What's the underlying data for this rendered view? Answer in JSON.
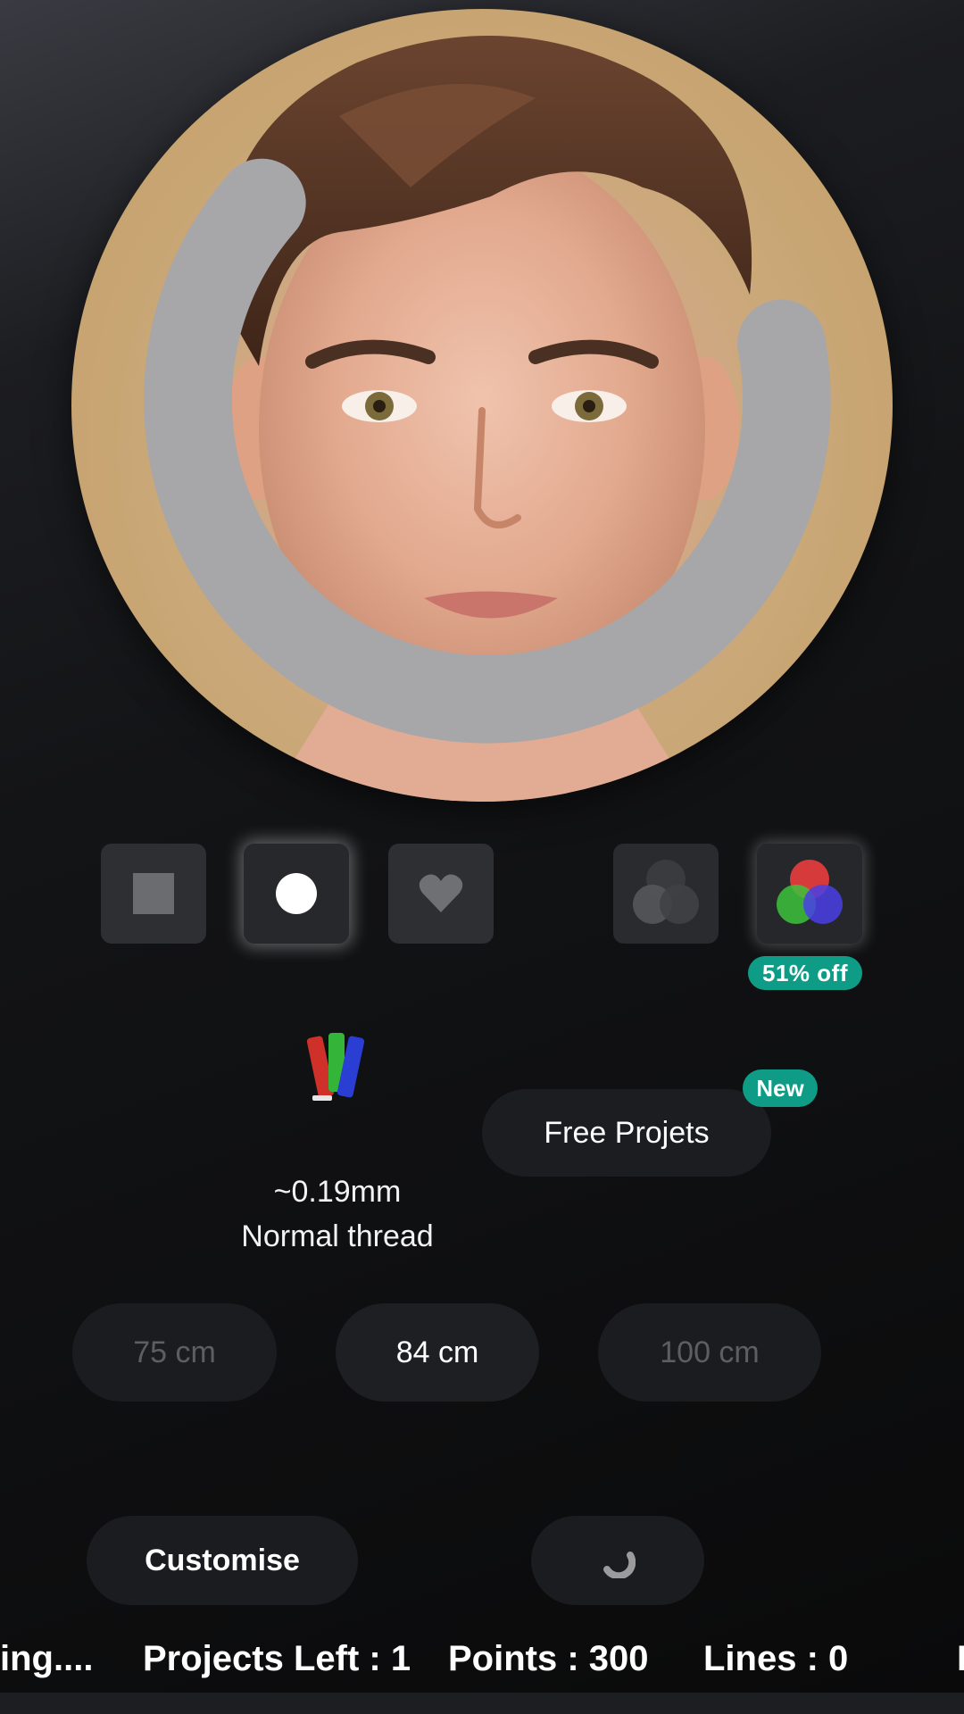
{
  "portrait": {
    "icon": "portrait-photo",
    "loading_icon": "spinner-icon"
  },
  "shapes": [
    {
      "icon": "square-icon",
      "active": false
    },
    {
      "icon": "circle-icon",
      "active": true
    },
    {
      "icon": "heart-icon",
      "active": false
    }
  ],
  "color_modes": [
    {
      "icon": "monochrome-circles-icon",
      "active": false
    },
    {
      "icon": "rgb-circles-icon",
      "active": true
    }
  ],
  "discount_badge": "51% off",
  "thread": {
    "icon": "thread-spools-icon",
    "size": "~0.19mm",
    "type": "Normal thread"
  },
  "free_projects": {
    "label": "Free Projets",
    "badge": "New"
  },
  "sizes": [
    {
      "label": "75 cm",
      "selected": false
    },
    {
      "label": "84 cm",
      "selected": true
    },
    {
      "label": "100 cm",
      "selected": false
    }
  ],
  "actions": {
    "customise_label": "Customise",
    "loader_icon": "spinner-icon"
  },
  "status": {
    "loading": "ing....",
    "projects_left": "Projects Left : 1",
    "points": "Points : 300",
    "lines": "Lines : 0",
    "trailing": "I"
  },
  "colors": {
    "accent_teal": "#0f9c86",
    "button_bg": "#1b1c1f"
  }
}
